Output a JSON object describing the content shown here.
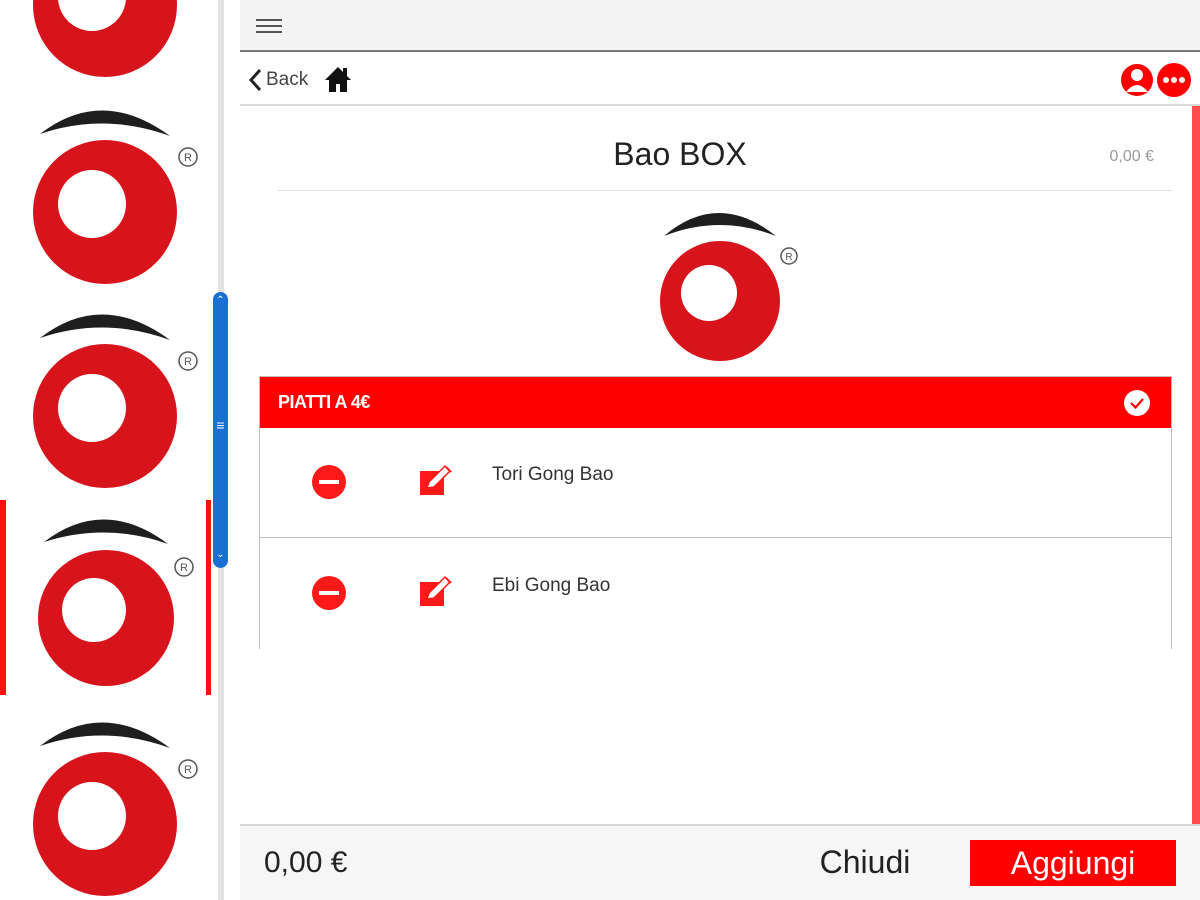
{
  "sidebar": {
    "logos": [
      {
        "icon": "brand-logo-icon",
        "selected": false
      },
      {
        "icon": "brand-logo-icon",
        "selected": false
      },
      {
        "icon": "brand-logo-icon",
        "selected": false
      },
      {
        "icon": "brand-logo-icon",
        "selected": true
      },
      {
        "icon": "brand-logo-icon",
        "selected": false
      }
    ],
    "scrollbar_icons": [
      "chevron-up-icon",
      "grip-icon",
      "chevron-down-icon"
    ]
  },
  "topbar": {
    "menu_icon": "hamburger-menu-icon"
  },
  "navbar": {
    "back_label": "Back",
    "back_icon": "chevron-left-icon",
    "home_icon": "home-icon",
    "user_icon": "user-icon",
    "more_icon": "more-icon"
  },
  "product": {
    "title": "Bao BOX",
    "price": "0,00 €"
  },
  "section": {
    "title": "PIATTI A 4€",
    "check_icon": "check-circle-icon",
    "items": [
      {
        "name": "Tori Gong Bao",
        "remove_icon": "remove-circle-icon",
        "edit_icon": "edit-icon"
      },
      {
        "name": "Ebi Gong Bao",
        "remove_icon": "remove-circle-icon",
        "edit_icon": "edit-icon"
      }
    ]
  },
  "footer": {
    "total": "0,00 €",
    "close_label": "Chiudi",
    "add_label": "Aggiungi"
  },
  "colors": {
    "accent": "#ff0000",
    "logo_red": "#d7141c",
    "logo_black": "#1e1e1e",
    "scroll_blue": "#1a6fd0"
  }
}
